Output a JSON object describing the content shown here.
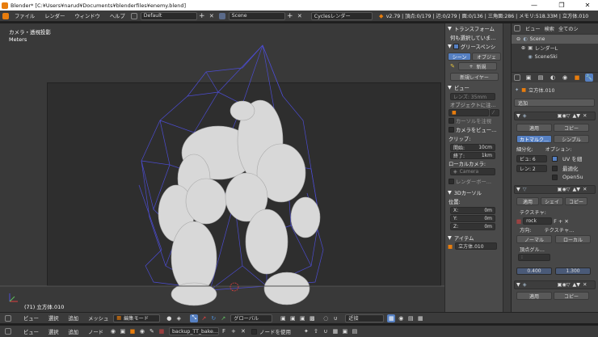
{
  "window": {
    "title": "Blender* [C:¥Users¥narud¥Documents¥blenderfiles¥enemy.blend]",
    "minimize": "—",
    "maximize": "❐",
    "close": "✕"
  },
  "topbar": {
    "menus": [
      "ファイル",
      "レンダー",
      "ウィンドウ",
      "ヘルプ"
    ],
    "layout": "Default",
    "scene": "Scene",
    "engine": "Cyclesレンダー",
    "stats": "v2.79 | 頂点:0/179 | 辺:0/279 | 面:0/136 | 三角面:286 | メモリ:518.33M | 立方体.010"
  },
  "viewport": {
    "info1": "カメラ・透視投影",
    "info2": "Meters",
    "object_label": "(71) 立方体.010"
  },
  "props_panel": {
    "transform_header": "トランスフォーム",
    "nothing_selected": "何も選択していま…",
    "grease_pencil": "グリースペンシ",
    "tab_scene": "シーン",
    "tab_object": "オブジェ",
    "new_label": "新規",
    "new_layer": "新規レイヤー",
    "view_header": "ビュー",
    "lens": "レンズ: 35mm",
    "lock_object": "オブジェクトに注…",
    "lock_cursor": "カーソルを注視",
    "camera_view": "カメラをビュー…",
    "clip_label": "クリップ:",
    "clip_start_label": "開始:",
    "clip_start": "10cm",
    "clip_end_label": "終了:",
    "clip_end": "1km",
    "local_camera": "ローカルカメラ:",
    "camera_field": "Camera",
    "render_border": "レンダーボー…",
    "cursor_header": "3Dカーソル",
    "location": "位置:",
    "x_label": "X:",
    "x_value": "0m",
    "y_label": "Y:",
    "y_value": "0m",
    "z_label": "Z:",
    "z_value": "0m",
    "item_header": "アイテム",
    "item_name": "立方体.010"
  },
  "outliner": {
    "tabs": [
      "ビュー",
      "検索",
      "全てのシ"
    ],
    "items": [
      "Scene",
      "レンダーL",
      "SceneSki"
    ]
  },
  "right_props": {
    "object_name": "立方体.010",
    "add_label": "追加",
    "mod1": {
      "apply": "適用",
      "copy": "コピー",
      "catmull": "カトマルク…",
      "simple": "シンプル",
      "subdiv": "細分化:",
      "options": "オプション:",
      "view_label": "ビュ: 6",
      "render_label": "レン: 2",
      "uv": "UV を細",
      "optimize": "最適化",
      "opensubdiv": "OpenSu"
    },
    "mod2": {
      "apply": "適用",
      "shape": "シェイ",
      "copy": "コピー",
      "texture": "テクスチャ:",
      "tex_name": "rock",
      "direction": "方向:",
      "tex_coord": "テクスチャ…",
      "normal": "ノーマル",
      "local": "ローカル",
      "vgroup": "頂点グル…",
      "midlevel": "0.400",
      "strength": "1.300"
    },
    "mod3": {
      "apply": "適用",
      "copy": "コピー"
    }
  },
  "bottom1": {
    "view": "ビュー",
    "select": "選択",
    "add": "追加",
    "mesh": "メッシュ",
    "mode": "編集モード",
    "orientation": "グローバル",
    "snap": "近接"
  },
  "bottom2": {
    "view": "ビュー",
    "select": "選択",
    "add": "追加",
    "node": "ノード",
    "image": "backup_TT_bake…",
    "use_nodes": "ノードを使用"
  },
  "colors": {
    "accent": "#5680c2",
    "wire": "#4c4cd0",
    "mesh": "#d8d8d8"
  }
}
